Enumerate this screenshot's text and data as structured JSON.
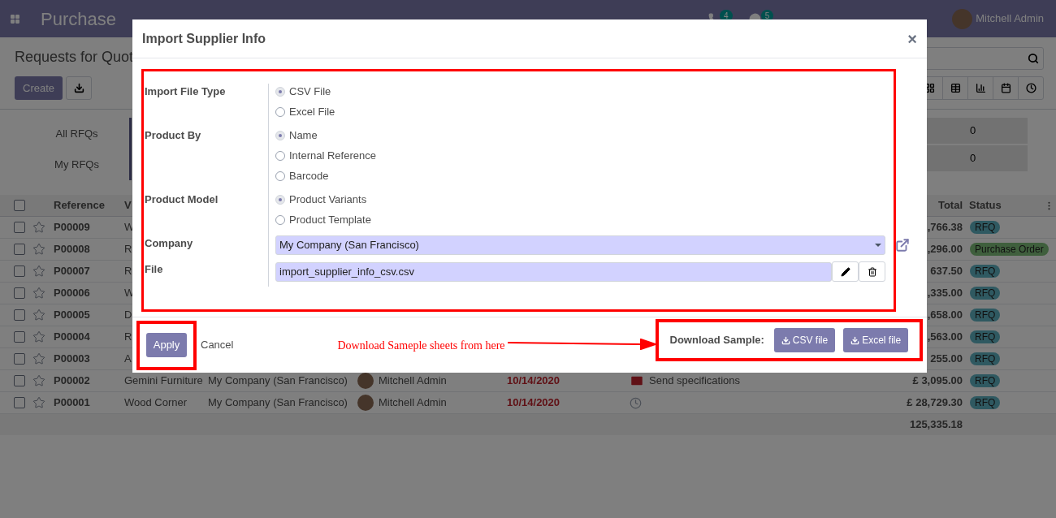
{
  "navbar": {
    "app_title": "Purchase",
    "activity_count": "4",
    "message_count": "5",
    "user": "Mitchell Admin"
  },
  "control_panel": {
    "title": "Requests for Quot",
    "create": "Create"
  },
  "dashboard": {
    "filters": [
      "All RFQs",
      "My RFQs"
    ],
    "counts": [
      "0",
      "0"
    ]
  },
  "table": {
    "all_checked": false,
    "columns": {
      "reference": "Reference",
      "vendor": "V",
      "total": "Total",
      "status": "Status"
    },
    "rows": [
      {
        "checked": false,
        "reference": "P00009",
        "vendor": "W",
        "total": ",766.38",
        "status": {
          "kind": "rfq",
          "text": "RFQ"
        }
      },
      {
        "checked": false,
        "reference": "P00008",
        "vendor": "R",
        "total": ",296.00",
        "status": {
          "kind": "order",
          "text": "Purchase Order"
        }
      },
      {
        "checked": false,
        "reference": "P00007",
        "vendor": "R",
        "total": "637.50",
        "status": {
          "kind": "rfq",
          "text": "RFQ"
        }
      },
      {
        "checked": false,
        "reference": "P00006",
        "vendor": "W",
        "total": ",335.00",
        "status": {
          "kind": "rfq",
          "text": "RFQ"
        }
      },
      {
        "checked": false,
        "reference": "P00005",
        "vendor": "D",
        "total": ",658.00",
        "status": {
          "kind": "rfq",
          "text": "RFQ"
        }
      },
      {
        "checked": false,
        "reference": "P00004",
        "vendor": "R",
        "total": ",563.00",
        "status": {
          "kind": "rfq",
          "text": "RFQ"
        }
      },
      {
        "checked": false,
        "reference": "P00003",
        "vendor": "A",
        "total": "255.00",
        "status": {
          "kind": "rfq",
          "text": "RFQ"
        }
      },
      {
        "checked": false,
        "reference": "P00002",
        "vendor": "Gemini Furniture",
        "company": "My Company (San Francisco)",
        "buyer": "Mitchell Admin",
        "deadline": "10/14/2020",
        "activity": {
          "kind": "email",
          "text": "Send specifications"
        },
        "total": "£ 3,095.00",
        "status": {
          "kind": "rfq",
          "text": "RFQ"
        }
      },
      {
        "checked": false,
        "reference": "P00001",
        "vendor": "Wood Corner",
        "company": "My Company (San Francisco)",
        "buyer": "Mitchell Admin",
        "deadline": "10/14/2020",
        "activity": {
          "kind": "clock"
        },
        "total": "£ 28,729.30",
        "status": {
          "kind": "rfq",
          "text": "RFQ"
        }
      }
    ],
    "sum": "125,335.18"
  },
  "dialog": {
    "title": "Import Supplier Info",
    "close": "×",
    "fields": [
      {
        "kind": "radio",
        "label": "Import File Type",
        "options": [
          {
            "label": "CSV File",
            "selected": true
          },
          {
            "label": "Excel File",
            "selected": false
          }
        ]
      },
      {
        "kind": "radio",
        "label": "Product By",
        "options": [
          {
            "label": "Name",
            "selected": true
          },
          {
            "label": "Internal Reference",
            "selected": false
          },
          {
            "label": "Barcode",
            "selected": false
          }
        ]
      },
      {
        "kind": "radio",
        "label": "Product Model",
        "options": [
          {
            "label": "Product Variants",
            "selected": true
          },
          {
            "label": "Product Template",
            "selected": false
          }
        ]
      },
      {
        "kind": "select",
        "label": "Company",
        "value": "My Company (San Francisco)"
      },
      {
        "kind": "file",
        "label": "File",
        "value": "import_supplier_info_csv.csv"
      }
    ],
    "apply": "Apply",
    "cancel": "Cancel",
    "sample_label": "Download Sample:",
    "sample_buttons": [
      "CSV file",
      "Excel file"
    ]
  },
  "annotation": {
    "text": "Download Sameple sheets from here"
  }
}
